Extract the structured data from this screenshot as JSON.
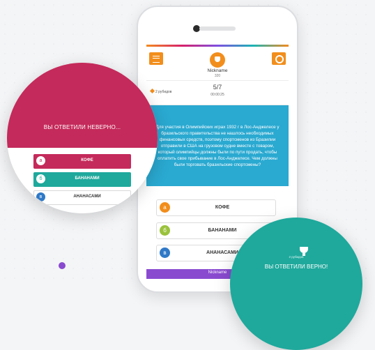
{
  "header": {
    "nickname": "Nickname",
    "score": "320"
  },
  "question_bar": {
    "rubies": "2 рубидов",
    "progress": "5/7",
    "timer": "00:00:25"
  },
  "question": {
    "text": "Для участия в Олимпийских играх 1932 г в Лос-Анджелесе у бразильского правительства не нашлось необходимых финансовых средств, поэтому спортсменов из Бразилии отправили в США на грузовом судне вместе с товаром, который олимпийцы должны были по пути продать, чтобы оплатить свое прибывание в Лос-Анджелесе. Чем должны были торговать бразильские спортсмены?"
  },
  "answers": [
    {
      "letter": "а",
      "label": "КОФЕ",
      "color": "#f28e1c"
    },
    {
      "letter": "б",
      "label": "БАНАНАМИ",
      "color": "#9ac23c"
    },
    {
      "letter": "в",
      "label": "АНАНАСАМИ",
      "color": "#2f79c7"
    }
  ],
  "bottom_bar": {
    "nickname": "Nickname"
  },
  "wrong_panel": {
    "title": "ВЫ ОТВЕТИЛИ НЕВЕРНО...",
    "answers": [
      {
        "letter": "а",
        "label": "КОФЕ"
      },
      {
        "letter": "б",
        "label": "БАНАНАМИ"
      },
      {
        "letter": "в",
        "label": "АНАНАСАМИ"
      }
    ]
  },
  "correct_panel": {
    "rubies": "2 рубидов",
    "title": "ВЫ ОТВЕТИЛИ ВЕРНО!"
  },
  "colors": {
    "accent_orange": "#f28e1c",
    "wrong_red": "#c42a5b",
    "correct_teal": "#1ea99c",
    "question_blue": "#2aa9d1",
    "purple": "#8a4ad0"
  }
}
